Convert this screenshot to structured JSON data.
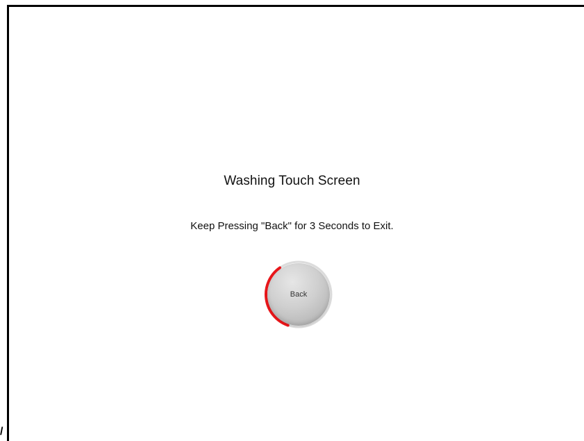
{
  "screen": {
    "title": "Washing Touch Screen",
    "instruction": "Keep Pressing \"Back\" for 3 Seconds to Exit."
  },
  "back_button": {
    "label": "Back",
    "hold_progress": 0.35,
    "progress_color": "#e8161a",
    "ring_color": "#dcdcdc"
  },
  "corner_text": "/"
}
